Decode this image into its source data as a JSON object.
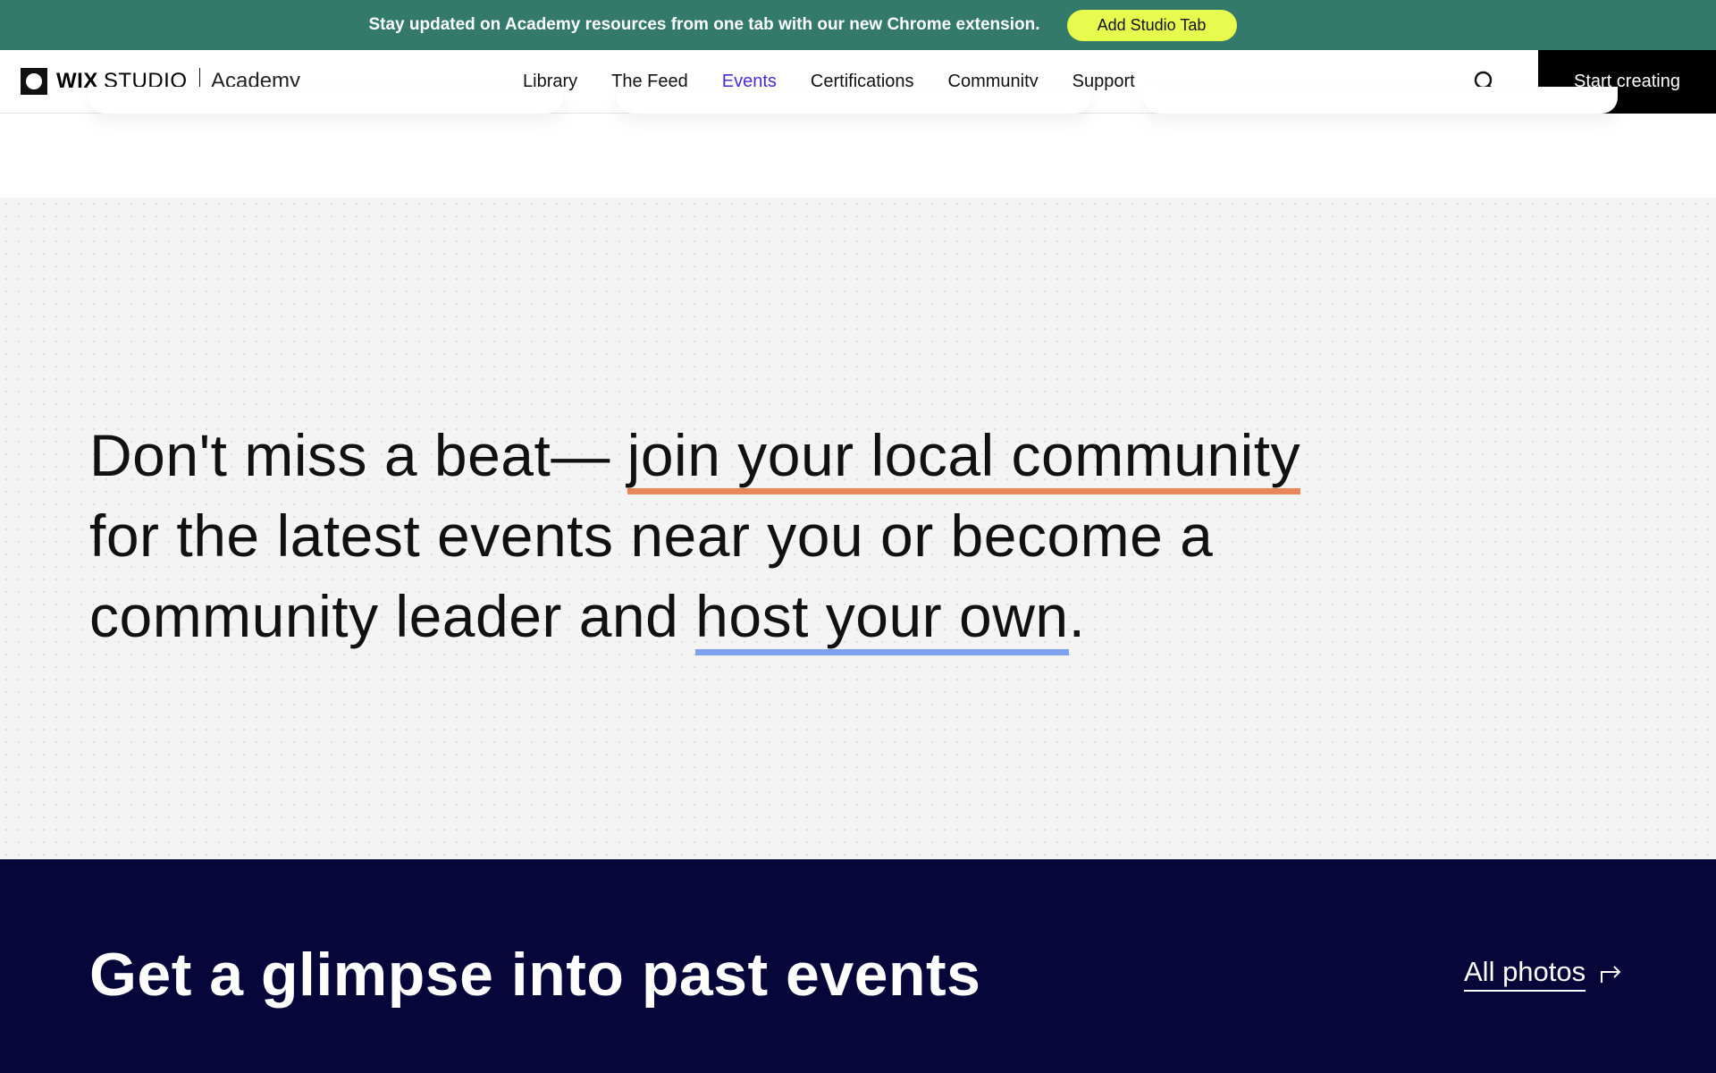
{
  "promo": {
    "text": "Stay updated on Academy resources from one tab with our new Chrome extension.",
    "button": "Add Studio Tab"
  },
  "nav": {
    "logo_wix": "WIX",
    "logo_studio": "STUDIO",
    "logo_academy": "Academy",
    "links": [
      {
        "label": "Library",
        "active": false
      },
      {
        "label": "The Feed",
        "active": false
      },
      {
        "label": "Events",
        "active": true
      },
      {
        "label": "Certifications",
        "active": false
      },
      {
        "label": "Community",
        "active": false
      },
      {
        "label": "Support",
        "active": false
      }
    ],
    "search_icon": "search-icon",
    "cta": "Start creating"
  },
  "community": {
    "part1": "Don't miss a beat— ",
    "highlight1": "join your local community",
    "part2": " for the latest events near you or become a community leader and ",
    "highlight2": "host your own",
    "part3": "."
  },
  "past_events": {
    "title": "Get a glimpse into past events",
    "link": "All photos",
    "link_icon": "arrow-right-icon"
  },
  "colors": {
    "promo_bg": "#347A6A",
    "promo_button": "#E6FB4E",
    "active_link": "#4A2BD8",
    "highlight_orange": "#E8885A",
    "highlight_blue": "#7FA2EE",
    "dark_section": "#06063A"
  }
}
